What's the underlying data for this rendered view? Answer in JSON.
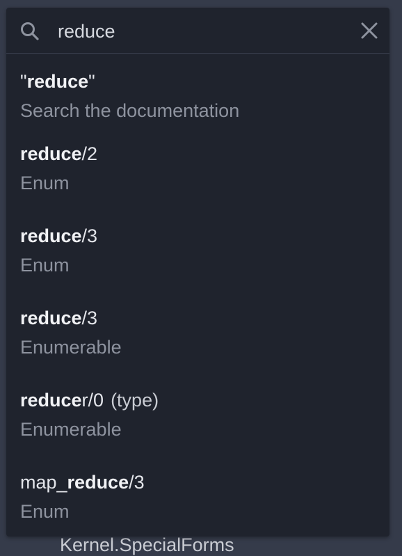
{
  "search": {
    "value": "reduce",
    "icon": "search-icon",
    "close_icon": "close-icon"
  },
  "results": [
    {
      "prefix": "\"",
      "match": "reduce",
      "suffix": "\"",
      "type": "",
      "subtitle": "Search the documentation"
    },
    {
      "prefix": "",
      "match": "reduce",
      "suffix": "/2",
      "type": "",
      "subtitle": "Enum"
    },
    {
      "prefix": "",
      "match": "reduce",
      "suffix": "/3",
      "type": "",
      "subtitle": "Enum"
    },
    {
      "prefix": "",
      "match": "reduce",
      "suffix": "/3",
      "type": "",
      "subtitle": "Enumerable"
    },
    {
      "prefix": "",
      "match": "reduce",
      "suffix": "r/0",
      "type": "(type)",
      "subtitle": "Enumerable"
    },
    {
      "prefix": "map_",
      "match": "reduce",
      "suffix": "/3",
      "type": "",
      "subtitle": "Enum"
    }
  ],
  "background_peek": "Kernel.SpecialForms",
  "colors": {
    "page_bg": "#353b4a",
    "panel_bg": "#1f232d",
    "text": "#e3e5ea",
    "muted": "#8e939f"
  }
}
